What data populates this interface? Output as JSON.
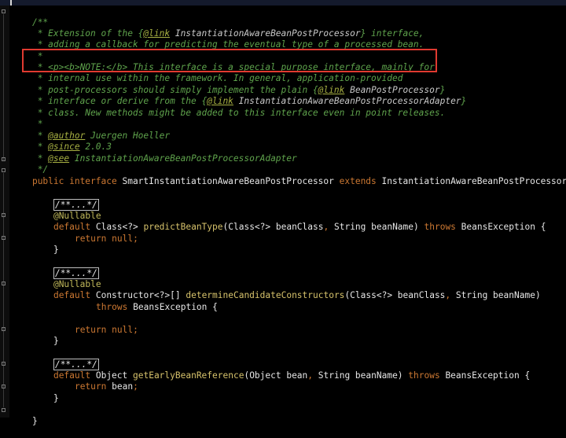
{
  "editor": {
    "language": "java",
    "colors": {
      "background": "#000000",
      "comment": "#5fa34c",
      "keyword": "#cc7832",
      "method": "#d6c26b",
      "highlight_box": "#e03a30"
    },
    "lines": {
      "l1": "/**",
      "l2a": " * Extension of the {",
      "l2b": "@link",
      "l2c": " InstantiationAwareBeanPostProcessor",
      "l2d": "} interface,",
      "l3": " * adding a callback for predicting the eventual type of a processed bean.",
      "l4": " *",
      "l5": " * <p><b>NOTE:</b> This interface is a special purpose interface, mainly for",
      "l6": " * internal use within the framework. In general, application-provided",
      "l7a": " * post-processors should simply implement the plain {",
      "l7b": "@link",
      "l7c": " BeanPostProcessor",
      "l7d": "}",
      "l8a": " * interface or derive from the {",
      "l8b": "@link",
      "l8c": " InstantiationAwareBeanPostProcessorAdapter",
      "l8d": "}",
      "l9": " * class. New methods might be added to this interface even in point releases.",
      "l10": " *",
      "l11a": " * ",
      "l11b": "@author",
      "l11c": " Juergen Hoeller",
      "l12a": " * ",
      "l12b": "@since",
      "l12c": " 2.0.3",
      "l13a": " * ",
      "l13b": "@see",
      "l13c": " InstantiationAwareBeanPostProcessorAdapter",
      "l14": " */",
      "l15a": "public interface",
      "l15b": " SmartInstantiationAwareBeanPostProcessor ",
      "l15c": "extends",
      "l15d": " InstantiationAwareBeanPostProcessor {",
      "folded": "/**...*/",
      "nullable": "@Nullable",
      "m1a": "default",
      "m1b": " Class<?> ",
      "m1c": "predictBeanType",
      "m1d": "(Class<?> beanClass",
      "m1e": ",",
      "m1f": " String beanName) ",
      "m1g": "throws",
      "m1h": " BeansException {",
      "ret_kw": "return",
      "null_kw": " null",
      "semi": ";",
      "close_brace": "}",
      "m2a": "default",
      "m2b": " Constructor<?>[] ",
      "m2c": "determineCandidateConstructors",
      "m2d": "(Class<?> beanClass",
      "m2e": ",",
      "m2f": " String beanName)",
      "m2g": "throws",
      "m2h": " BeansException {",
      "m3a": "default",
      "m3b": " Object ",
      "m3c": "getEarlyBeanReference",
      "m3d": "(Object bean",
      "m3e": ",",
      "m3f": " String beanName) ",
      "m3g": "throws",
      "m3h": " BeansException {",
      "m3ret": " bean",
      "class_close": "}"
    }
  }
}
